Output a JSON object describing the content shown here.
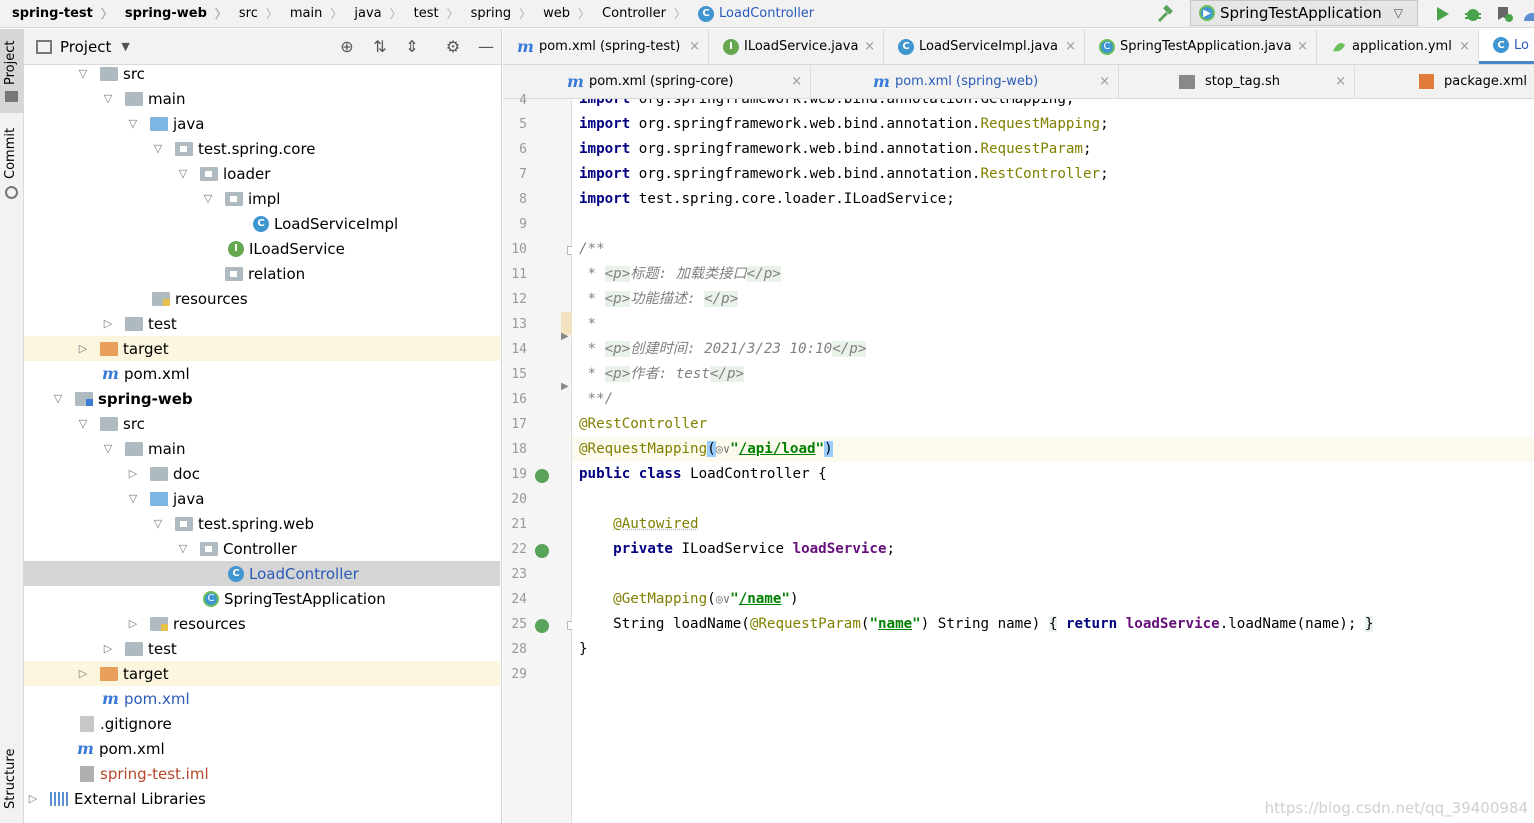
{
  "breadcrumb": [
    "spring-test",
    "spring-web",
    "src",
    "main",
    "java",
    "test",
    "spring",
    "web",
    "Controller",
    "LoadController"
  ],
  "run_config": "SpringTestApplication",
  "left_stripe": {
    "project": "Project",
    "commit": "Commit",
    "structure": "Structure"
  },
  "project_panel": {
    "title": "Project",
    "tree": [
      {
        "label": "src"
      },
      {
        "label": "main"
      },
      {
        "label": "java"
      },
      {
        "label": "test.spring.core"
      },
      {
        "label": "loader"
      },
      {
        "label": "impl"
      },
      {
        "label": "LoadServiceImpl"
      },
      {
        "label": "ILoadService"
      },
      {
        "label": "relation"
      },
      {
        "label": "resources"
      },
      {
        "label": "test"
      },
      {
        "label": "target"
      },
      {
        "label": "pom.xml"
      },
      {
        "label": "spring-web"
      },
      {
        "label": "src"
      },
      {
        "label": "main"
      },
      {
        "label": "doc"
      },
      {
        "label": "java"
      },
      {
        "label": "test.spring.web"
      },
      {
        "label": "Controller"
      },
      {
        "label": "LoadController"
      },
      {
        "label": "SpringTestApplication"
      },
      {
        "label": "resources"
      },
      {
        "label": "test"
      },
      {
        "label": "target"
      },
      {
        "label": "pom.xml"
      },
      {
        "label": ".gitignore"
      },
      {
        "label": "pom.xml"
      },
      {
        "label": "spring-test.iml"
      },
      {
        "label": "External Libraries"
      }
    ]
  },
  "tabs_row1": [
    "pom.xml (spring-test)",
    "ILoadService.java",
    "LoadServiceImpl.java",
    "SpringTestApplication.java",
    "application.yml",
    "Lo"
  ],
  "tabs_row2": [
    "pom.xml (spring-core)",
    "pom.xml (spring-web)",
    "stop_tag.sh",
    "package.xml"
  ],
  "editor": {
    "line_numbers": [
      "4",
      "5",
      "6",
      "7",
      "8",
      "9",
      "10",
      "11",
      "12",
      "13",
      "14",
      "15",
      "16",
      "17",
      "18",
      "19",
      "20",
      "21",
      "22",
      "23",
      "24",
      "25",
      "28",
      "29"
    ],
    "imports": {
      "l4": "org.springframework.web.bind.annotation.GetMapping;",
      "l5_pkg": "org.springframework.web.bind.annotation.",
      "l5_cls": "RequestMapping",
      "l6_cls": "RequestParam",
      "l7_cls": "RestController",
      "l8": "test.spring.core.loader.ILoadService;"
    },
    "kw_import": "import",
    "doc": {
      "open": "/**",
      "star": " * ",
      "p_open": "<p>",
      "p_close": "</p>",
      "title": "标题: 加载类接口",
      "desc": "功能描述: ",
      "created": "创建时间: 2021/3/23 10:10",
      "author": "作者: test",
      "close": " **/"
    },
    "ann_rest": "@RestController",
    "ann_reqmap": "@RequestMapping",
    "path_load": "/api/load",
    "kw_public": "public",
    "kw_class": "class",
    "class_name": "LoadController {",
    "ann_autowired": "@Autowired",
    "kw_private": "private",
    "field_type": "ILoadService",
    "field_name": "loadService",
    "ann_getmap": "@GetMapping",
    "path_name": "/name",
    "method_sig": "String loadName(",
    "ann_reqparam": "@RequestParam",
    "param_name": "name",
    "param_rest": ") String name)",
    "kw_return": "return",
    "call_rest": ".loadName(name);",
    "close_brace": "}"
  },
  "watermark": "https://blog.csdn.net/qq_39400984",
  "colors": {
    "keyword": "#000080",
    "annotation": "#808000",
    "string": "#008000",
    "field": "#660e7a",
    "selection": "#d5d5d5",
    "highlight_row": "#fbf6dd"
  }
}
